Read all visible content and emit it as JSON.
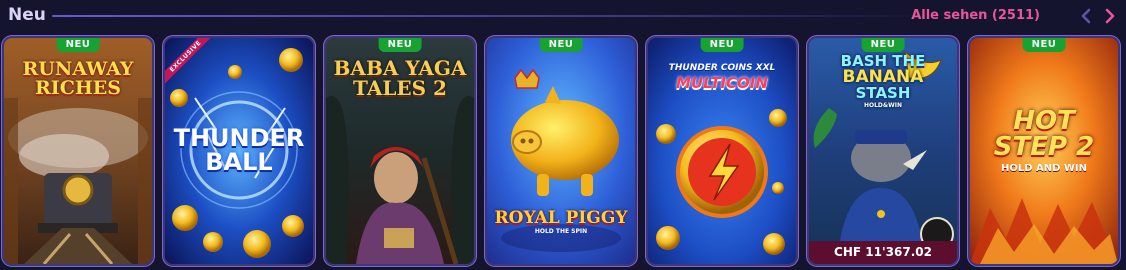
{
  "header": {
    "title": "Neu",
    "see_all": "Alle sehen (2511)",
    "prev_icon": "chevron-left-icon",
    "next_icon": "chevron-right-icon",
    "colors": {
      "accent": "#e8559a",
      "badge": "#16a332",
      "prev_arrow": "#5a56b0",
      "next_arrow": "#e8559a"
    }
  },
  "games": [
    {
      "id": "runaway-riches",
      "badge": "NEU",
      "ribbon": "",
      "logo": [
        "RUNAWAY",
        "RICHES"
      ],
      "sub": "",
      "price": ""
    },
    {
      "id": "thunder-ball",
      "badge": "",
      "ribbon": "EXCLUSIVE",
      "logo": [
        "THUNDER",
        "BALL"
      ],
      "sub": "",
      "price": ""
    },
    {
      "id": "baba-yaga-tales-2",
      "badge": "NEU",
      "ribbon": "",
      "logo": [
        "BABA YAGA",
        "TALES 2"
      ],
      "sub": "",
      "price": ""
    },
    {
      "id": "royal-piggy",
      "badge": "NEU",
      "ribbon": "",
      "logo": [
        "ROYAL PIGGY"
      ],
      "sub": "HOLD THE SPIN",
      "price": ""
    },
    {
      "id": "thunder-coins-xxl",
      "badge": "NEU",
      "ribbon": "",
      "logo": [
        "THUNDER COINS XXL",
        "MULTICOIN"
      ],
      "sub": "",
      "price": ""
    },
    {
      "id": "bash-the-banana-stash",
      "badge": "NEU",
      "ribbon": "",
      "logo": [
        "BASH THE",
        "BANANA",
        "STASH"
      ],
      "sub": "HOLD&WIN",
      "price": "CHF 11'367.02"
    },
    {
      "id": "hot-step-2",
      "badge": "NEU",
      "ribbon": "",
      "logo": [
        "HOT",
        "STEP 2"
      ],
      "sub": "HOLD AND WIN",
      "price": ""
    }
  ]
}
